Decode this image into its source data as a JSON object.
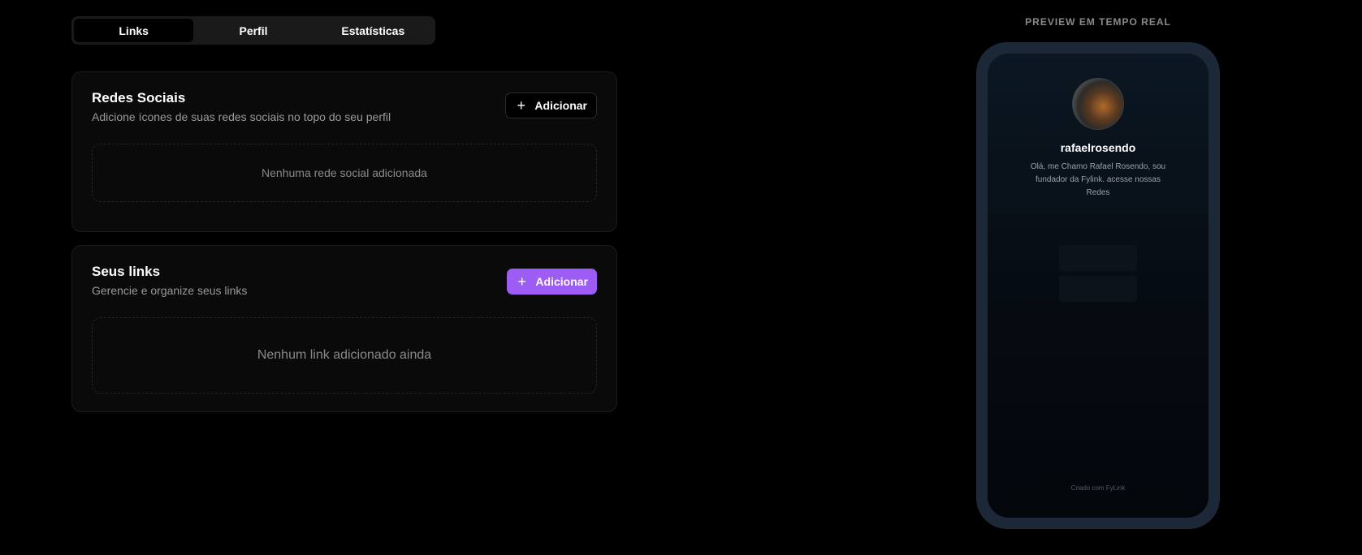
{
  "tabs": [
    {
      "label": "Links",
      "active": true
    },
    {
      "label": "Perfil",
      "active": false
    },
    {
      "label": "Estatísticas",
      "active": false
    }
  ],
  "social": {
    "title": "Redes Sociais",
    "subtitle": "Adicione ícones de suas redes sociais no topo do seu perfil",
    "add_label": "Adicionar",
    "empty_text": "Nenhuma rede social adicionada"
  },
  "links": {
    "title": "Seus links",
    "subtitle": "Gerencie e organize seus links",
    "add_label": "Adicionar",
    "empty_text": "Nenhum link adicionado ainda"
  },
  "preview": {
    "label": "PREVIEW EM TEMPO REAL",
    "username": "rafaelrosendo",
    "bio": "Olá, me Chamo Rafael Rosendo, sou fundador da Fylink. acesse nossas Redes",
    "footer": "Criado com FyLink"
  },
  "colors": {
    "accent": "#9d5cf3",
    "background": "#000000",
    "card": "#0a0a0a",
    "phone_frame": "#1c2738"
  },
  "icons": {
    "add": "plus-icon"
  }
}
